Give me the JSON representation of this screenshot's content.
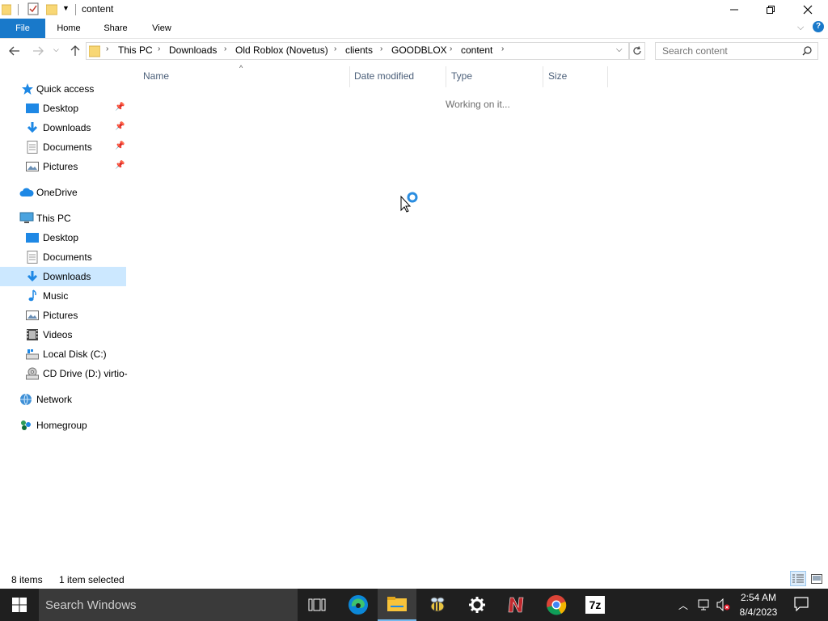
{
  "window": {
    "title": "content"
  },
  "ribbon": {
    "file": "File",
    "home": "Home",
    "share": "Share",
    "view": "View"
  },
  "breadcrumb": [
    "This PC",
    "Downloads",
    "Old Roblox (Novetus)",
    "clients",
    "GOODBLOX",
    "content"
  ],
  "search": {
    "placeholder": "Search content"
  },
  "nav": {
    "quick_access": "Quick access",
    "qa_desktop": "Desktop",
    "qa_downloads": "Downloads",
    "qa_documents": "Documents",
    "qa_pictures": "Pictures",
    "onedrive": "OneDrive",
    "this_pc": "This PC",
    "pc_desktop": "Desktop",
    "pc_documents": "Documents",
    "pc_downloads": "Downloads",
    "pc_music": "Music",
    "pc_pictures": "Pictures",
    "pc_videos": "Videos",
    "local_disk": "Local Disk (C:)",
    "cd_drive": "CD Drive (D:) virtio-",
    "network": "Network",
    "homegroup": "Homegroup"
  },
  "columns": {
    "name": "Name",
    "date_modified": "Date modified",
    "type": "Type",
    "size": "Size"
  },
  "content": {
    "working": "Working on it..."
  },
  "status": {
    "items": "8 items",
    "selected": "1 item selected"
  },
  "taskbar": {
    "search_placeholder": "Search Windows",
    "time": "2:54 AM",
    "date": "8/4/2023",
    "app_7z": "7z"
  },
  "colors": {
    "accent": "#1979ca",
    "selection": "#cce8ff",
    "taskbar": "#1f1f1f"
  }
}
